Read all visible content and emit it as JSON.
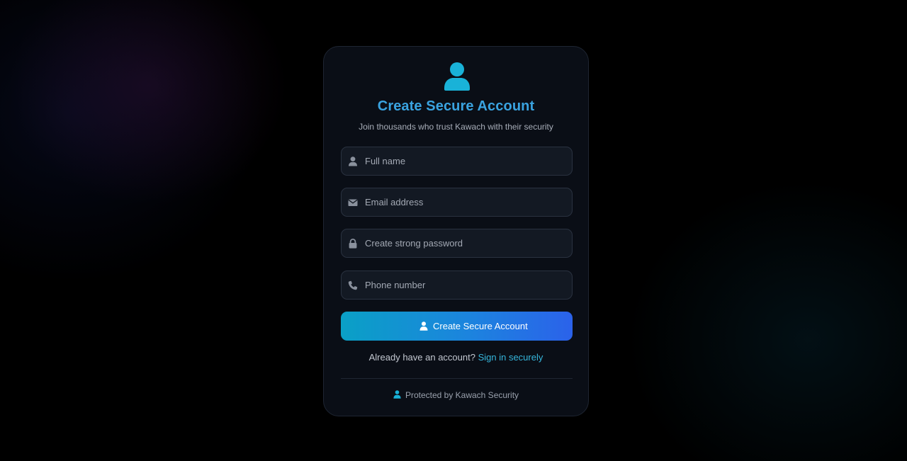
{
  "colors": {
    "accent": "#3aa3e0",
    "icon_cyan": "#19b2d8",
    "link": "#36b6dc",
    "button_gradient_start": "#0aa0c6",
    "button_gradient_end": "#2b62ea",
    "card_bg": "#0a0e16",
    "field_bg": "#131923"
  },
  "header": {
    "icon": "user-icon",
    "title": "Create Secure Account",
    "subtitle": "Join thousands who trust Kawach with their security"
  },
  "form": {
    "fields": [
      {
        "icon": "user-icon",
        "placeholder": "Full name",
        "value": ""
      },
      {
        "icon": "envelope-icon",
        "placeholder": "Email address",
        "value": ""
      },
      {
        "icon": "lock-icon",
        "placeholder": "Create strong password",
        "value": ""
      },
      {
        "icon": "phone-icon",
        "placeholder": "Phone number",
        "value": ""
      }
    ],
    "submit": {
      "icon": "user-icon",
      "label": "Create Secure Account"
    }
  },
  "signin": {
    "prompt": "Already have an account?",
    "link_label": "Sign in securely"
  },
  "footer": {
    "icon": "user-icon",
    "text": "Protected by Kawach Security"
  }
}
